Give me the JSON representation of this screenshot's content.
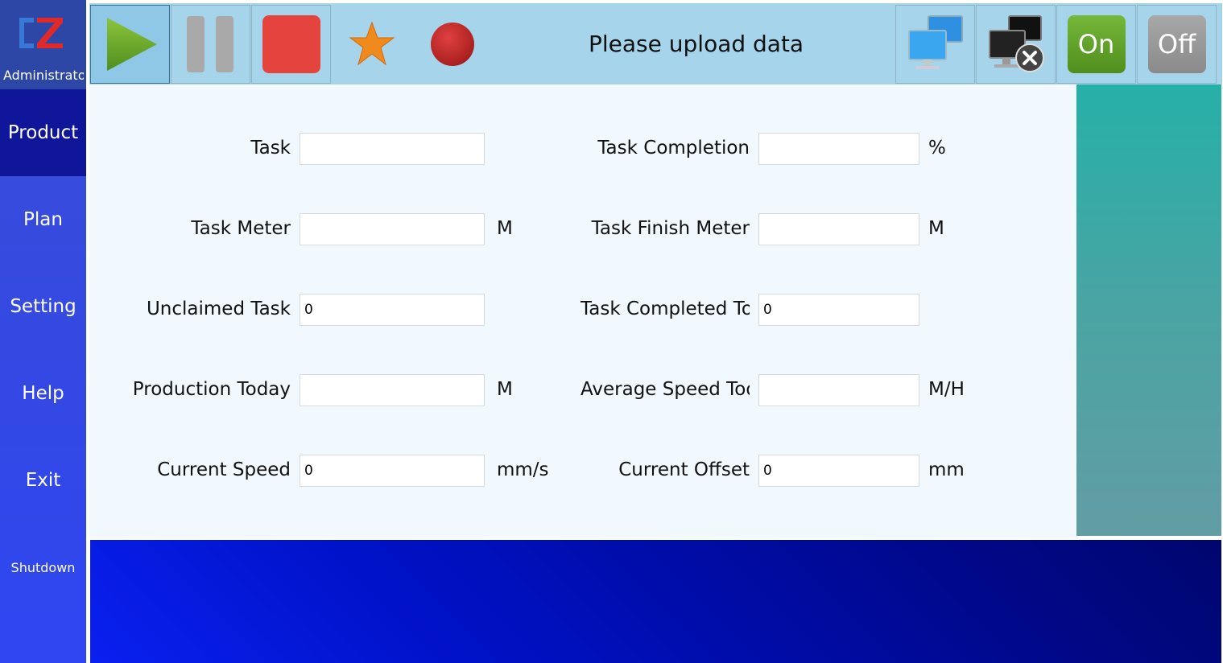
{
  "sidebar": {
    "logo_text": "CZ",
    "user": "Administrator",
    "items": [
      {
        "label": "Product"
      },
      {
        "label": "Plan"
      },
      {
        "label": "Setting"
      },
      {
        "label": "Help"
      },
      {
        "label": "Exit"
      },
      {
        "label": "Shutdown"
      }
    ]
  },
  "toolbar": {
    "status": "Please upload data",
    "on_label": "On",
    "off_label": "Off"
  },
  "form": {
    "task": {
      "label": "Task",
      "value": ""
    },
    "task_completion": {
      "label": "Task Completion",
      "value": "",
      "unit": "%"
    },
    "task_meter": {
      "label": "Task Meter",
      "value": "",
      "unit": "M"
    },
    "task_finish_meter": {
      "label": "Task Finish Meter",
      "value": "",
      "unit": "M"
    },
    "unclaimed_task": {
      "label": "Unclaimed Task",
      "value": "0"
    },
    "task_completed_today": {
      "label": "Task Completed Today",
      "value": "0"
    },
    "production_today": {
      "label": "Production Today",
      "value": "",
      "unit": "M"
    },
    "average_speed_today": {
      "label": "Average Speed Today",
      "value": "",
      "unit": "M/H"
    },
    "current_speed": {
      "label": "Current Speed",
      "value": "0",
      "unit": "mm/s"
    },
    "current_offset": {
      "label": "Current Offset",
      "value": "0",
      "unit": "mm"
    }
  },
  "colors": {
    "sidebar": "#3348e4",
    "active_nav": "#10169a",
    "toolbar": "#a6d4ea",
    "on_green": "#5fa02a",
    "off_gray": "#9a9a9a"
  }
}
